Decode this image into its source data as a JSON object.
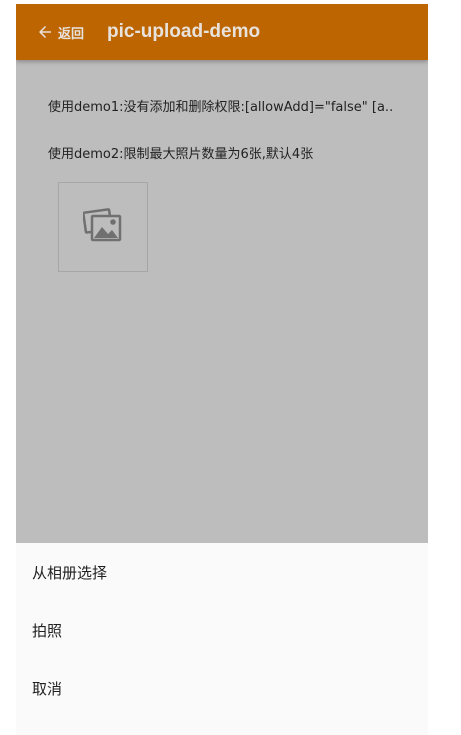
{
  "toolbar": {
    "back_label": "返回",
    "title": "pic-upload-demo",
    "color": "#bd6501"
  },
  "content": {
    "demo1_text": "使用demo1:没有添加和删除权限:[allowAdd]=\"false\" [a..",
    "demo2_text": "使用demo2:限制最大照片数量为6张,默认4张",
    "thumbnail_icon": "images-icon"
  },
  "action_sheet": {
    "items": [
      {
        "label": "从相册选择"
      },
      {
        "label": "拍照"
      },
      {
        "label": "取消"
      }
    ]
  }
}
